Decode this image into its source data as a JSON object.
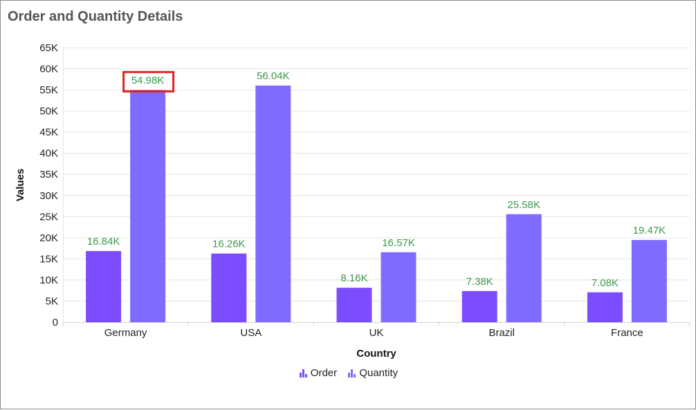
{
  "title": "Order and Quantity Details",
  "chart_data": {
    "type": "bar",
    "categories": [
      "Germany",
      "USA",
      "UK",
      "Brazil",
      "France"
    ],
    "series": [
      {
        "name": "Order",
        "values": [
          16840,
          16260,
          8160,
          7380,
          7080
        ],
        "labels": [
          "16.84K",
          "16.26K",
          "8.16K",
          "7.38K",
          "7.08K"
        ],
        "color": "#7c4dff"
      },
      {
        "name": "Quantity",
        "values": [
          54980,
          56040,
          16570,
          25580,
          19470
        ],
        "labels": [
          "54.98K",
          "56.04K",
          "16.57K",
          "25.58K",
          "19.47K"
        ],
        "color": "#7f6cff"
      }
    ],
    "xlabel": "Country",
    "ylabel": "Values",
    "ylim": [
      0,
      65000
    ],
    "yticks": [
      0,
      5000,
      10000,
      15000,
      20000,
      25000,
      30000,
      35000,
      40000,
      45000,
      50000,
      55000,
      60000,
      65000
    ],
    "ytick_labels": [
      "0",
      "5K",
      "10K",
      "15K",
      "20K",
      "25K",
      "30K",
      "35K",
      "40K",
      "45K",
      "50K",
      "55K",
      "60K",
      "65K"
    ],
    "grid": true,
    "legend": "bottom-center",
    "highlight": {
      "series": "Quantity",
      "category": "Germany",
      "color": "#e02020"
    },
    "label_color": "#3a9a4a"
  }
}
